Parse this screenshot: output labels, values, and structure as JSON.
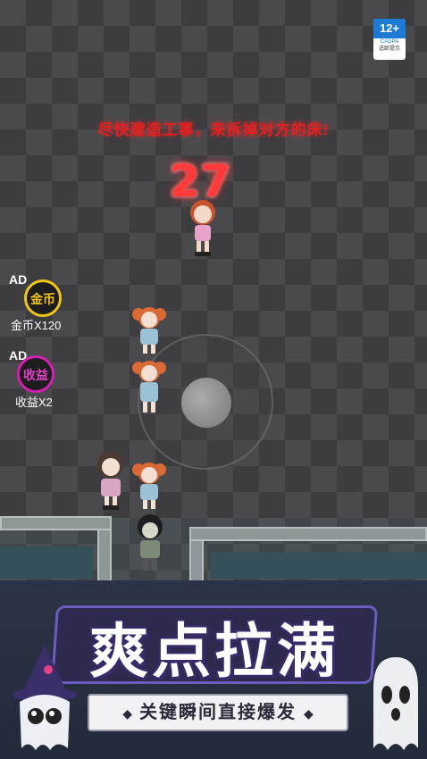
{
  "rating": {
    "age": "12+",
    "org": "CADPA",
    "note": "适龄提示"
  },
  "hint_text": "尽快建造工事，来拆掉对方的床!",
  "countdown": "27",
  "ad_buttons": [
    {
      "tag": "AD",
      "icon": "coin-badge-icon",
      "icon_text": "金币",
      "label": "金币X120",
      "color": "#f0c419"
    },
    {
      "tag": "AD",
      "icon": "income-badge-icon",
      "icon_text": "收益",
      "label": "收益X2",
      "color": "#d51fb3"
    }
  ],
  "banner": {
    "title": "爽点拉满",
    "subtitle": "关键瞬间直接爆发",
    "bullet": "◆"
  }
}
